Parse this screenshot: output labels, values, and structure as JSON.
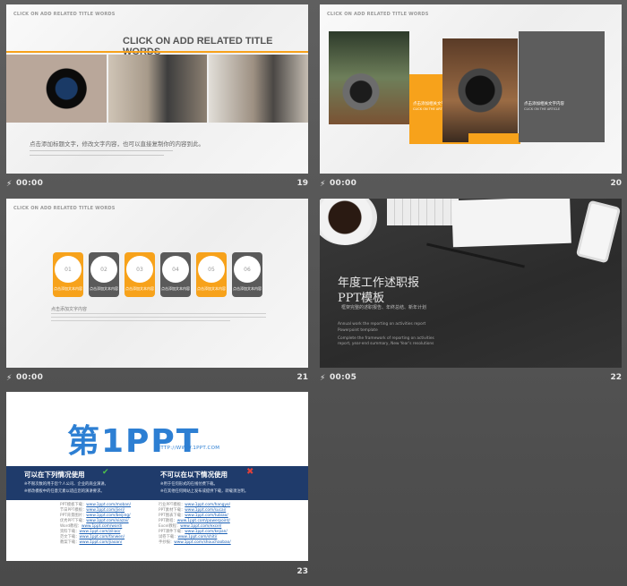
{
  "slides": [
    {
      "id": 19,
      "number": "19",
      "time": "00:00",
      "top_label": "CLICK ON ADD RELATED TITLE WORDS",
      "title": "CLICK ON ADD RELATED TITLE WORDS",
      "body": "点击添加标题文字，修改文字内容，也可以直接复制你的内容到此。"
    },
    {
      "id": 20,
      "number": "20",
      "time": "00:00",
      "top_label": "CLICK ON ADD RELATED TITLE WORDS",
      "box_title_1": "点击添加相关文字内容",
      "box_sub_1": "CLICK ON THE ARTICLE",
      "box_title_2": "点击添加相关文字内容",
      "box_sub_2": "CLICK ON THE ARTICLE"
    },
    {
      "id": 21,
      "number": "21",
      "time": "00:00",
      "top_label": "CLICK ON ADD RELATED TITLE WORDS",
      "steps": [
        {
          "num": "01",
          "label": "点击添加文本内容",
          "color": "#f7a21b"
        },
        {
          "num": "02",
          "label": "点击添加文本内容",
          "color": "#5a5a5a"
        },
        {
          "num": "03",
          "label": "点击添加文本内容",
          "color": "#f7a21b"
        },
        {
          "num": "04",
          "label": "点击添加文本内容",
          "color": "#5a5a5a"
        },
        {
          "num": "05",
          "label": "点击添加文本内容",
          "color": "#f7a21b"
        },
        {
          "num": "06",
          "label": "点击添加文本内容",
          "color": "#5a5a5a"
        }
      ],
      "desc_title": "点击添加文字内容"
    },
    {
      "id": 22,
      "number": "22",
      "time": "00:05",
      "title_line1": "年度工作述职报",
      "title_line2": "PPT模板",
      "subtitle": "框架完整的述职报告、年终总结、新年计划",
      "en_1": "Annual work the reporting on activities report",
      "en_2": "Powerpoint template",
      "en_3": "Complete the framework of reporting on activities",
      "en_4": "report, year-end summary, New Year's resolutions"
    },
    {
      "id": 23,
      "number": "23",
      "logo_main": "第1PPT",
      "logo_url": "HTTP://WWW.1PPT.COM",
      "can_title": "可以在下列情况使用",
      "cannot_title": "不可以在以下情况使用",
      "can_1": "※不限次数的用于您个人公司、企业的商业演讲。",
      "can_2": "※修改模板中的任意元素以适应您的演讲要求。",
      "cannot_1": "※用于任何形式的在线付费下载。",
      "cannot_2": "※在其他任何网站上发布或提供下载，转载须注明。",
      "links_left": [
        {
          "label": "PPT模板下载：",
          "url": "www.1ppt.com/moban/"
        },
        {
          "label": "节日PPT模板：",
          "url": "www.1ppt.com/jieri/"
        },
        {
          "label": "PPT背景图片：",
          "url": "www.1ppt.com/beijing/"
        },
        {
          "label": "优秀PPT下载：",
          "url": "www.1ppt.com/xiazai/"
        },
        {
          "label": "Word教程：",
          "url": "www.1ppt.com/word/"
        },
        {
          "label": "资料下载：",
          "url": "www.1ppt.com/ziliao/"
        },
        {
          "label": "范文下载：",
          "url": "www.1ppt.com/fanwen/"
        },
        {
          "label": "教案下载：",
          "url": "www.1ppt.com/jiaoan/"
        }
      ],
      "links_right": [
        {
          "label": "行业PPT模板：",
          "url": "www.1ppt.com/hangye/"
        },
        {
          "label": "PPT素材下载：",
          "url": "www.1ppt.com/sucai/"
        },
        {
          "label": "PPT图表下载：",
          "url": "www.1ppt.com/tubiao/"
        },
        {
          "label": "PPT教程：",
          "url": "www.1ppt.com/powerpoint/"
        },
        {
          "label": "Excel教程：",
          "url": "www.1ppt.com/excel/"
        },
        {
          "label": "PPT课件下载：",
          "url": "www.1ppt.com/kejian/"
        },
        {
          "label": "试卷下载：",
          "url": "www.1ppt.com/shiti/"
        },
        {
          "label": "手抄报：",
          "url": "www.1ppt.com/shouchaobao/"
        }
      ]
    }
  ]
}
